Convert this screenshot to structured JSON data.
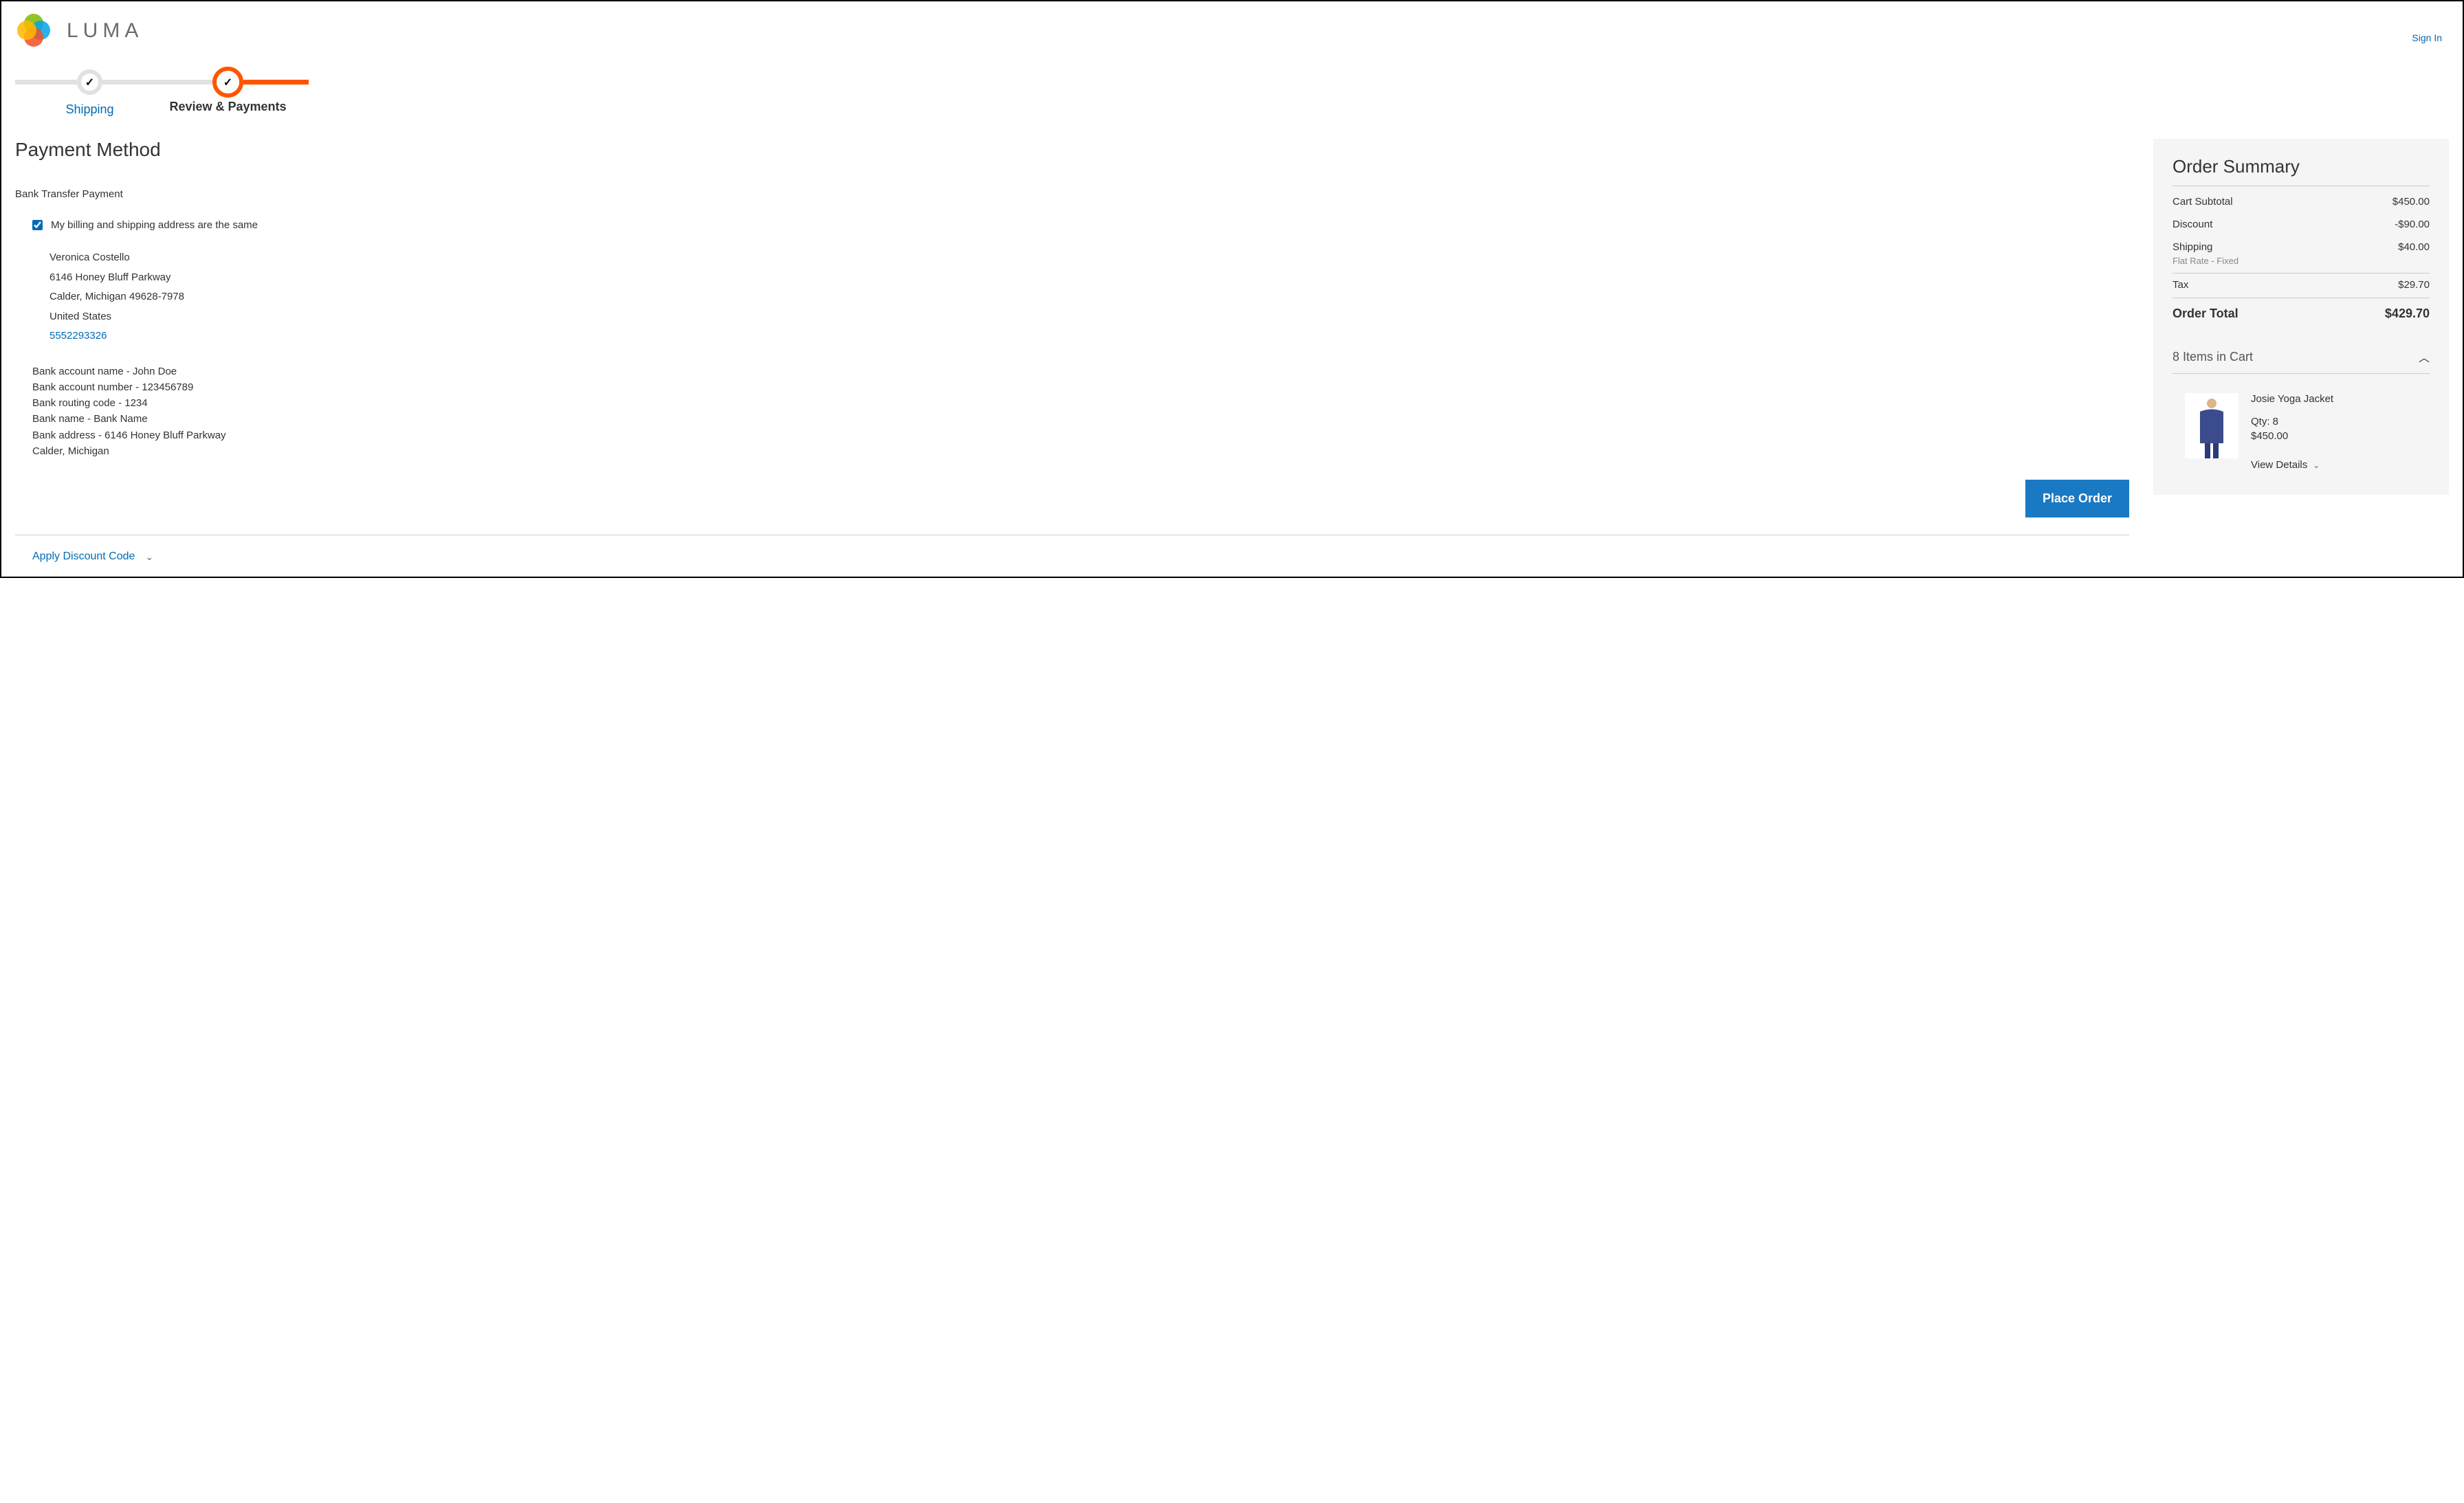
{
  "header": {
    "brand": "LUMA",
    "signin": "Sign In"
  },
  "progress": {
    "step1": "Shipping",
    "step2": "Review & Payments"
  },
  "payment": {
    "title": "Payment Method",
    "method_name": "Bank Transfer Payment",
    "same_address_label": "My billing and shipping address are the same",
    "address": {
      "name": "Veronica Costello",
      "street": "6146 Honey Bluff Parkway",
      "citystate": "Calder, Michigan 49628-7978",
      "country": "United States",
      "phone": "5552293326"
    },
    "bank": {
      "l1": "Bank account name - John Doe",
      "l2": "Bank account number - 123456789",
      "l3": "Bank routing code - 1234",
      "l4": "Bank name - Bank Name",
      "l5": "Bank address - 6146 Honey Bluff Parkway",
      "l6": "Calder, Michigan"
    },
    "place_order": "Place Order",
    "discount_toggle": "Apply Discount Code"
  },
  "summary": {
    "title": "Order Summary",
    "subtotal_label": "Cart Subtotal",
    "subtotal_value": "$450.00",
    "discount_label": "Discount",
    "discount_value": "-$90.00",
    "shipping_label": "Shipping",
    "shipping_value": "$40.00",
    "shipping_method": "Flat Rate - Fixed",
    "tax_label": "Tax",
    "tax_value": "$29.70",
    "total_label": "Order Total",
    "total_value": "$429.70",
    "items_in_cart": "8 Items in Cart",
    "item": {
      "name": "Josie Yoga Jacket",
      "qty": "Qty: 8",
      "price": "$450.00",
      "view_details": "View Details"
    }
  }
}
